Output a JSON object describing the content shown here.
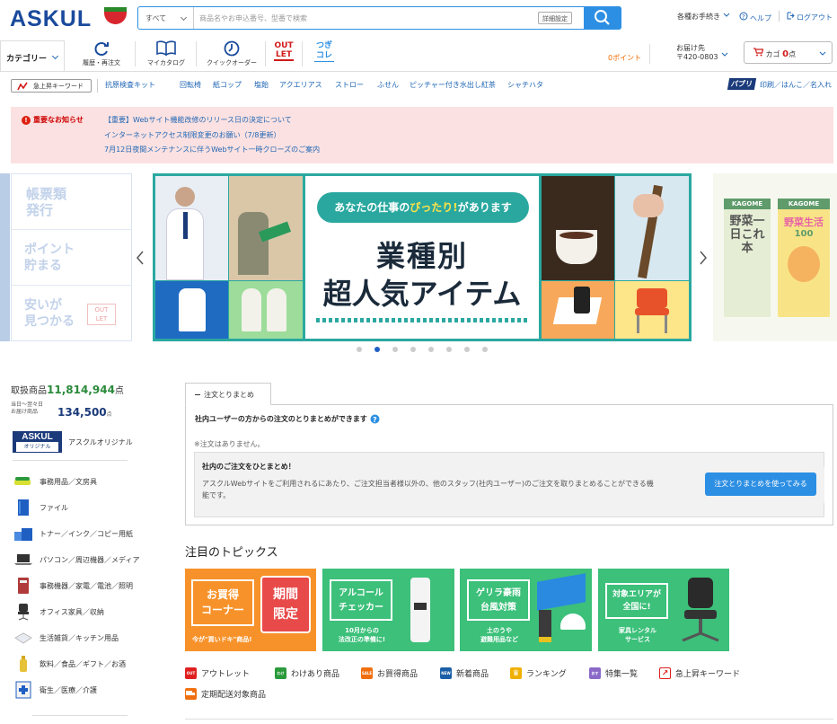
{
  "header": {
    "logo": "ASKUL",
    "search": {
      "scope": "すべて",
      "placeholder": "商品名やお申込番号、型番で検索",
      "advanced": "詳細設定"
    },
    "links": [
      "各種お手続き",
      "ヘルプ",
      "ログアウト"
    ]
  },
  "nav": {
    "category": "カテゴリー",
    "items": [
      "履歴・再注文",
      "マイカタログ",
      "クイックオーダー"
    ],
    "outlet": [
      "OUT",
      "LET"
    ],
    "tsugi": [
      "つぎ",
      "コレ"
    ],
    "points": "0ポイント",
    "delivery_label": "お届け先",
    "delivery_zip": "〒420-0803",
    "cart_label": "カゴ",
    "cart_count": "0",
    "cart_unit": "点"
  },
  "keywords": {
    "button": "急上昇キーワード",
    "items": [
      "抗原検査キット",
      "回転椅",
      "紙コップ",
      "塩飴",
      "アクエリアス",
      "ストロー",
      "ふせん",
      "ピッチャー付き水出し紅茶",
      "シャチハタ"
    ],
    "pabri_logo": "パブリ",
    "pabri_text": "印刷／はんこ／名入れ"
  },
  "notice": {
    "title": "重要なお知らせ",
    "items": [
      "【重要】Webサイト機能改修のリリース日の決定について",
      "インターネットアクセス制限変更のお願い（7/8更新）",
      "7月12日夜間メンテナンスに伴うWebサイト一時クローズのご案内"
    ]
  },
  "banner": {
    "left": [
      "帳票類\n発行",
      "ポイント\n貯まる",
      "安いが\n見つかる"
    ],
    "left_badge": [
      "OUT",
      "LET"
    ],
    "pill_a": "あなたの仕事の",
    "pill_b": "ぴったり!",
    "pill_c": "があります",
    "line1": "業種別",
    "line2": "超人気アイテム",
    "right_brand": "KAGOME",
    "right_big": [
      "野",
      "菜",
      "一",
      "日",
      "こ",
      "れ",
      "本"
    ],
    "right_text2": "野菜生活",
    "right_text3": "100",
    "dots": 8,
    "active_dot": 1
  },
  "sidebar": {
    "count_label": "取扱商品",
    "count_value": "11,814,944",
    "count_unit": "点",
    "next_day_label": [
      "当日～翌々日",
      "お届け商品"
    ],
    "next_day_value": "134,500",
    "next_day_unit": "点",
    "original_logo": [
      "ASKUL",
      "オリジナル"
    ],
    "original_label": "アスクルオリジナル",
    "categories": [
      "事務用品／文房具",
      "ファイル",
      "トナー／インク／コピー用紙",
      "パソコン／周辺機器／メディア",
      "事務機器／家電／電池／照明",
      "オフィス家具／収納",
      "生活雑貨／キッチン用品",
      "飲料／食品／ギフト／お酒",
      "衛生／医療／介護"
    ]
  },
  "order": {
    "tab": "注文とりまとめ",
    "heading": "社内ユーザーの方からの注文のとりまとめができます",
    "empty": "※注文はありません。",
    "box_title": "社内のご注文をひとまとめ！",
    "box_text_1": "アスクルWebサイトをご利用されるにあたり、ご注文担当者様以外の、他のスタッフ(社内ユーザー)のご注文を取りまとめることができる機",
    "box_text_2": "能です。",
    "cta": "注文とりまとめを使ってみる"
  },
  "topics": {
    "title": "注目のトピックス",
    "tiles": [
      {
        "main": "お買得\nコーナー",
        "badge": "期間\n限定",
        "sub": "今が\"買いドキ\"商品!"
      },
      {
        "main": "アルコール\nチェッカー",
        "sub": "10月からの\n法改正の準備に!"
      },
      {
        "main": "ゲリラ豪雨\n台風対策",
        "sub": "土のうや\n避難用品など"
      },
      {
        "main": "対象エリアが\n全国に!",
        "sub": "家具レンタル\nサービス"
      }
    ],
    "links": [
      {
        "label": "アウトレット",
        "badge": "OUT",
        "color": "#e02020"
      },
      {
        "label": "わけあり商品",
        "badge": "わけ",
        "color": "#2a9a3a"
      },
      {
        "label": "お買得商品",
        "badge": "SALE",
        "color": "#f07010"
      },
      {
        "label": "新着商品",
        "badge": "NEW",
        "color": "#1a5fa8"
      },
      {
        "label": "ランキング",
        "badge": "♛",
        "color": "#f0b000"
      },
      {
        "label": "特集一覧",
        "badge": "おす",
        "color": "#8a6ac8"
      },
      {
        "label": "急上昇キーワード",
        "badge": "↗",
        "color": "#e02020"
      }
    ],
    "link_extra": "定期配送対象商品"
  }
}
